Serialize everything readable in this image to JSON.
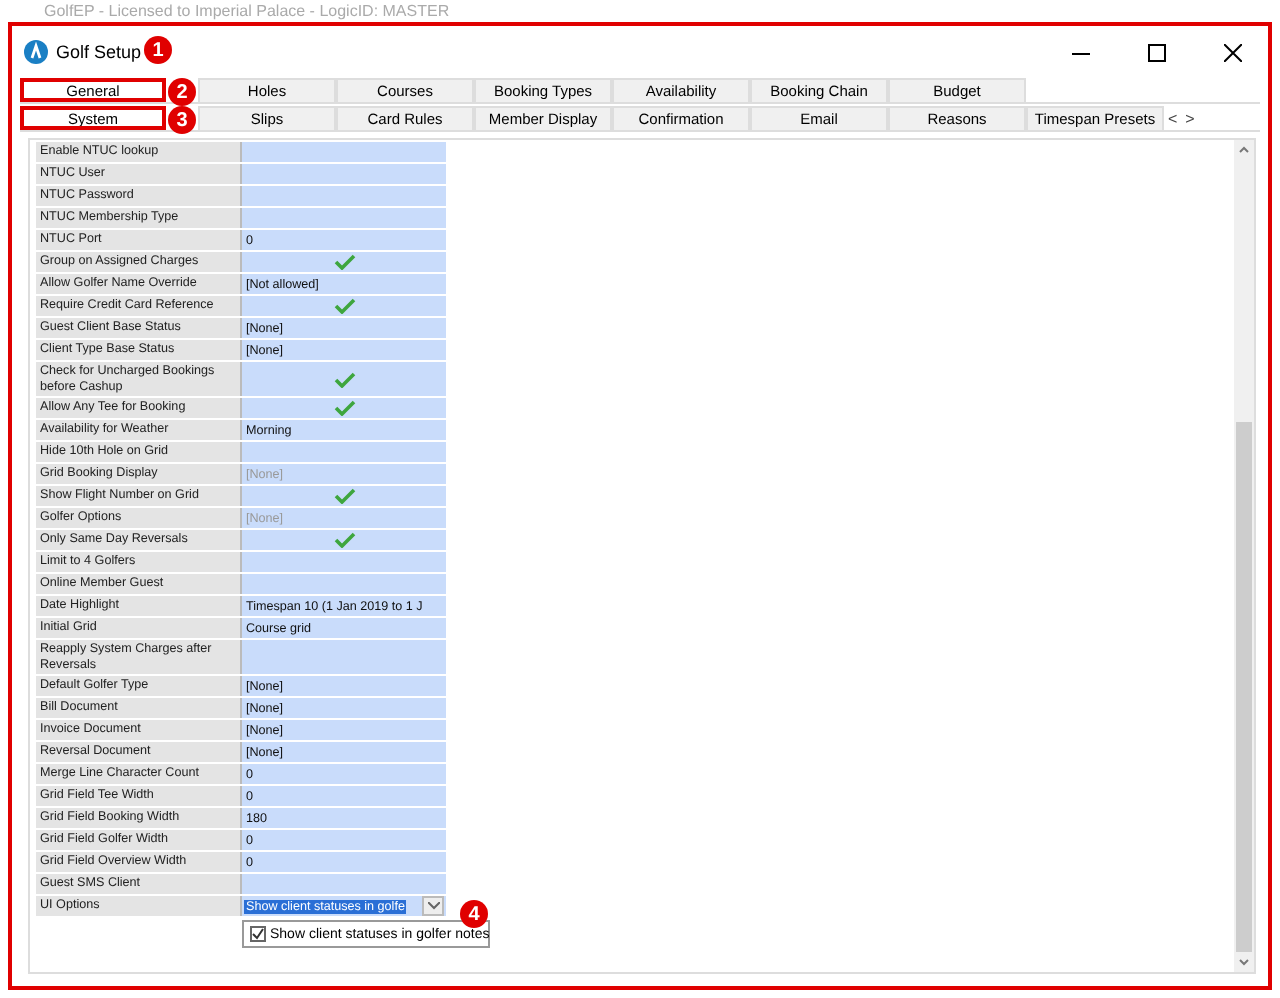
{
  "background_window": {
    "title": "GolfEP - Licensed to Imperial Palace - LogicID: MASTER"
  },
  "window": {
    "title": "Golf Setup"
  },
  "tab_rows": [
    {
      "tabs": [
        {
          "label": "General",
          "selected": true
        },
        {
          "label": "Holes",
          "selected": false
        },
        {
          "label": "Courses",
          "selected": false
        },
        {
          "label": "Booking Types",
          "selected": false
        },
        {
          "label": "Availability",
          "selected": false
        },
        {
          "label": "Booking Chain",
          "selected": false
        },
        {
          "label": "Budget",
          "selected": false
        }
      ]
    },
    {
      "tabs": [
        {
          "label": "System",
          "selected": true
        },
        {
          "label": "Slips",
          "selected": false
        },
        {
          "label": "Card Rules",
          "selected": false
        },
        {
          "label": "Member Display",
          "selected": false
        },
        {
          "label": "Confirmation",
          "selected": false
        },
        {
          "label": "Email",
          "selected": false
        },
        {
          "label": "Reasons",
          "selected": false
        },
        {
          "label": "Timespan Presets",
          "selected": false
        }
      ]
    }
  ],
  "tab_scroll": {
    "prev": "<",
    "next": ">"
  },
  "properties": [
    {
      "label": "Enable NTUC lookup",
      "kind": "text"
    },
    {
      "label": "NTUC User",
      "kind": "text"
    },
    {
      "label": "NTUC Password",
      "kind": "text"
    },
    {
      "label": "NTUC Membership Type",
      "kind": "text"
    },
    {
      "label": "NTUC Port",
      "kind": "text",
      "value": "0"
    },
    {
      "label": "Group on Assigned Charges",
      "kind": "check",
      "checked": true
    },
    {
      "label": "Allow Golfer Name Override",
      "kind": "text",
      "value": "[Not allowed]"
    },
    {
      "label": "Require Credit Card Reference",
      "kind": "check",
      "checked": true
    },
    {
      "label": "Guest Client Base Status",
      "kind": "text",
      "value": "[None]"
    },
    {
      "label": "Client Type Base Status",
      "kind": "text",
      "value": "[None]"
    },
    {
      "label": "Check for Uncharged Bookings before Cashup",
      "kind": "check",
      "checked": true
    },
    {
      "label": "Allow Any Tee for Booking",
      "kind": "check",
      "checked": true
    },
    {
      "label": "Availability for Weather",
      "kind": "text",
      "value": "Morning"
    },
    {
      "label": "Hide 10th Hole on Grid",
      "kind": "text"
    },
    {
      "label": "Grid Booking Display",
      "kind": "muted",
      "value": "[None]"
    },
    {
      "label": "Show Flight Number on Grid",
      "kind": "check",
      "checked": true
    },
    {
      "label": "Golfer Options",
      "kind": "muted",
      "value": "[None]"
    },
    {
      "label": "Only Same Day Reversals",
      "kind": "check",
      "checked": true
    },
    {
      "label": "Limit to 4 Golfers",
      "kind": "text"
    },
    {
      "label": "Online Member Guest",
      "kind": "text"
    },
    {
      "label": "Date Highlight",
      "kind": "text",
      "value": "Timespan 10 (1 Jan 2019 to 1 J"
    },
    {
      "label": "Initial Grid",
      "kind": "text",
      "value": "Course grid"
    },
    {
      "label": "Reapply System Charges after Reversals",
      "kind": "text"
    },
    {
      "label": "Default Golfer Type",
      "kind": "text",
      "value": "[None]"
    },
    {
      "label": "Bill Document",
      "kind": "text",
      "value": "[None]"
    },
    {
      "label": "Invoice Document",
      "kind": "text",
      "value": "[None]"
    },
    {
      "label": "Reversal Document",
      "kind": "text",
      "value": "[None]"
    },
    {
      "label": "Merge Line Character Count",
      "kind": "text",
      "value": "0"
    },
    {
      "label": "Grid Field Tee Width",
      "kind": "text",
      "value": "0"
    },
    {
      "label": "Grid Field Booking Width",
      "kind": "text",
      "value": "180"
    },
    {
      "label": "Grid Field Golfer Width",
      "kind": "text",
      "value": "0"
    },
    {
      "label": "Grid Field Overview Width",
      "kind": "text",
      "value": "0"
    },
    {
      "label": "Guest SMS Client",
      "kind": "text"
    },
    {
      "label": "UI Options",
      "kind": "dropdown",
      "value": "Show client statuses in golfe"
    }
  ],
  "dropdown_popup": {
    "options": [
      {
        "label": "Show client statuses in golfer notes",
        "checked": true
      }
    ]
  },
  "annotations": [
    "1",
    "2",
    "3",
    "4"
  ]
}
